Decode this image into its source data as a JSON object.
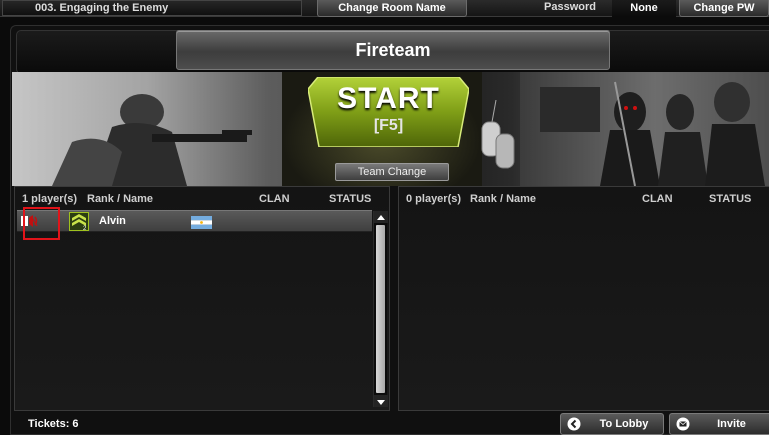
{
  "room": {
    "title": "003. Engaging the Enemy",
    "change_name_label": "Change Room Name",
    "password_label": "Password",
    "password_value": "None",
    "change_pw_label": "Change PW"
  },
  "mode": {
    "title": "Fireteam"
  },
  "start": {
    "label": "START",
    "hotkey": "[F5]",
    "team_change_label": "Team Change"
  },
  "left_team": {
    "count_label": "1 player(s)",
    "columns": {
      "rank_name": "Rank / Name",
      "clan": "CLAN",
      "status": "STATUS"
    },
    "players": [
      {
        "name": "Alvin",
        "flag": "argentina-flag",
        "rank_icon": "sergeant-rank-icon",
        "voice": "speaker-muted-icon"
      }
    ]
  },
  "right_team": {
    "count_label": "0 player(s)",
    "columns": {
      "rank_name": "Rank / Name",
      "clan": "CLAN",
      "status": "STATUS"
    },
    "players": []
  },
  "footer": {
    "tickets_label": "Tickets: 6",
    "to_lobby_label": "To Lobby",
    "invite_label": "Invite"
  },
  "colors": {
    "accent_green": "#8fb51c",
    "highlight_red": "#e1141a",
    "flag_blue": "#74acdf"
  }
}
